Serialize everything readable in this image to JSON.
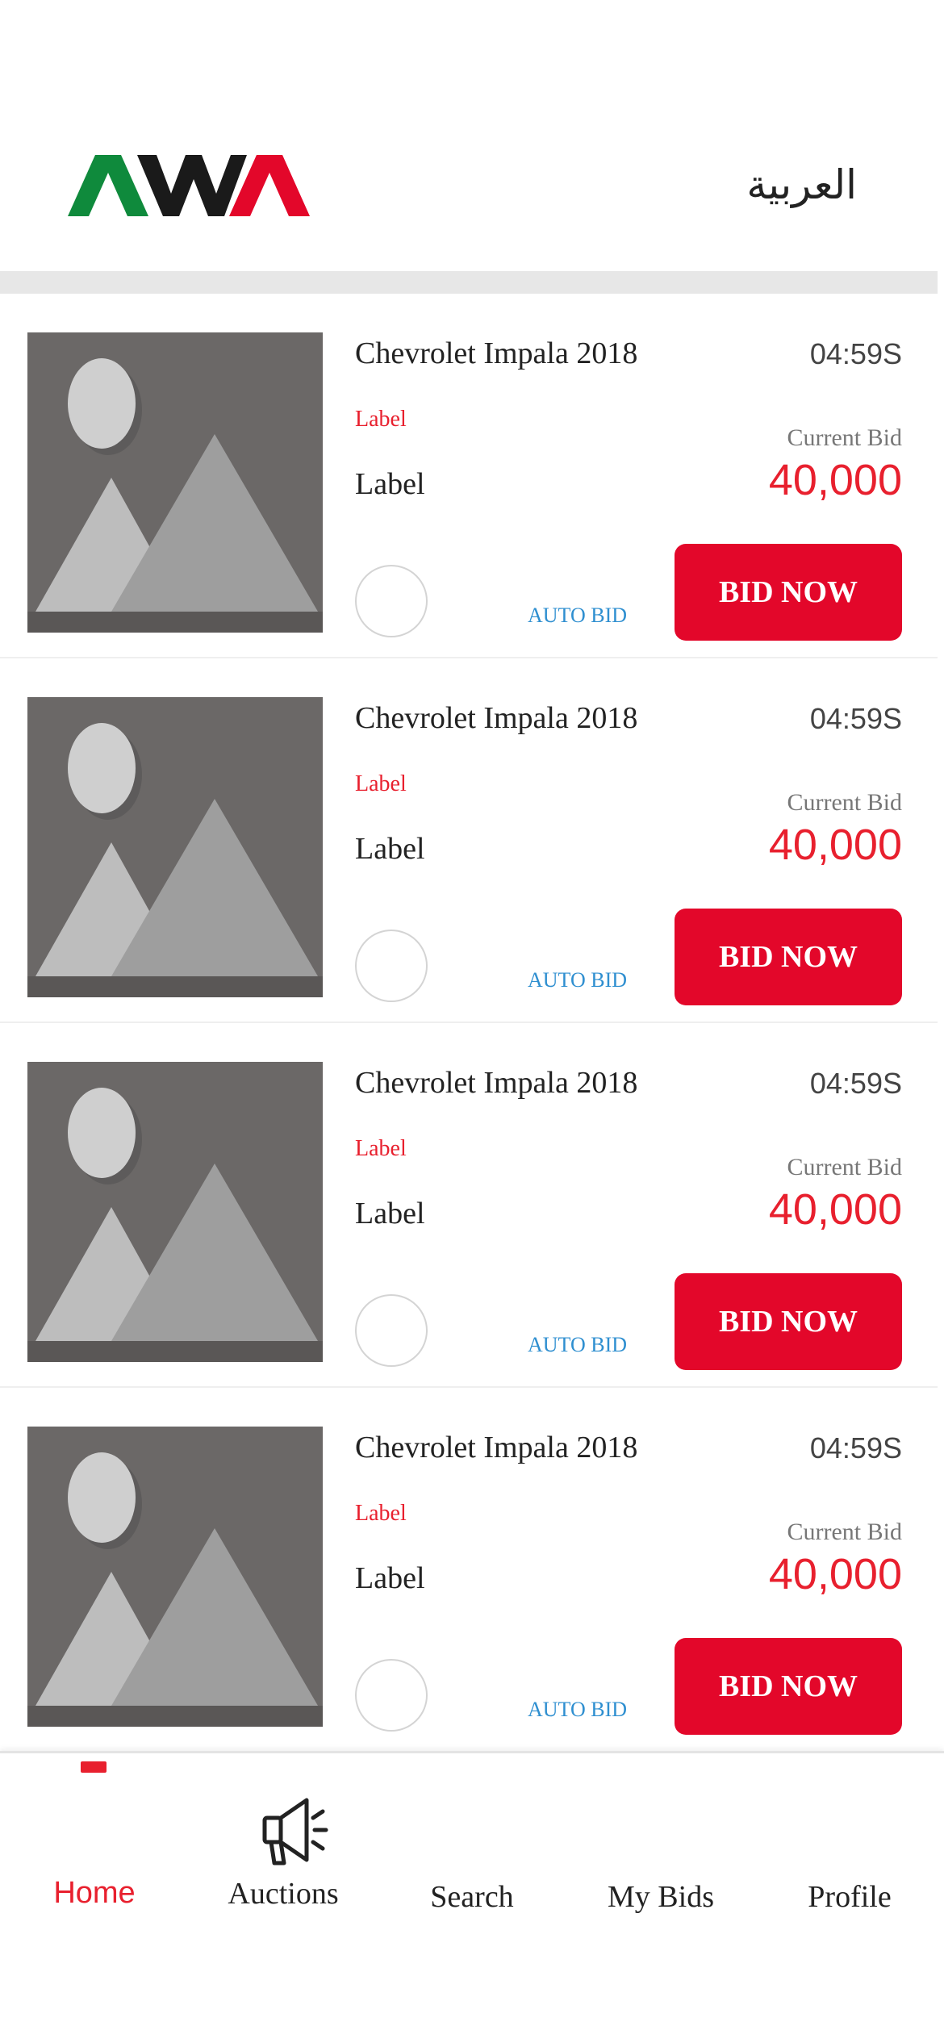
{
  "header": {
    "logo_text": "AWA",
    "language_switch": "العربية"
  },
  "auctions": [
    {
      "title": "Chevrolet Impala 2018",
      "timer": "04:59S",
      "red_label": "Label",
      "label": "Label",
      "bid_caption": "Current Bid",
      "bid_amount": "40,000",
      "auto_bid": "AUTO BID",
      "bid_button": "BID NOW"
    },
    {
      "title": "Chevrolet Impala 2018",
      "timer": "04:59S",
      "red_label": "Label",
      "label": "Label",
      "bid_caption": "Current Bid",
      "bid_amount": "40,000",
      "auto_bid": "AUTO BID",
      "bid_button": "BID NOW"
    },
    {
      "title": "Chevrolet Impala 2018",
      "timer": "04:59S",
      "red_label": "Label",
      "label": "Label",
      "bid_caption": "Current Bid",
      "bid_amount": "40,000",
      "auto_bid": "AUTO BID",
      "bid_button": "BID NOW"
    },
    {
      "title": "Chevrolet Impala 2018",
      "timer": "04:59S",
      "red_label": "Label",
      "label": "Label",
      "bid_caption": "Current Bid",
      "bid_amount": "40,000",
      "auto_bid": "AUTO BID",
      "bid_button": "BID NOW"
    }
  ],
  "bottom_nav": {
    "items": [
      {
        "label": "Home",
        "active": true
      },
      {
        "label": "Auctions",
        "icon": "megaphone-icon"
      },
      {
        "label": "Search"
      },
      {
        "label": "My Bids"
      },
      {
        "label": "Profile"
      }
    ]
  },
  "colors": {
    "accent_red": "#e3072a",
    "logo_green": "#0f8a3c",
    "logo_black": "#1a1a1a",
    "auto_bid_blue": "#2f8fd0"
  }
}
